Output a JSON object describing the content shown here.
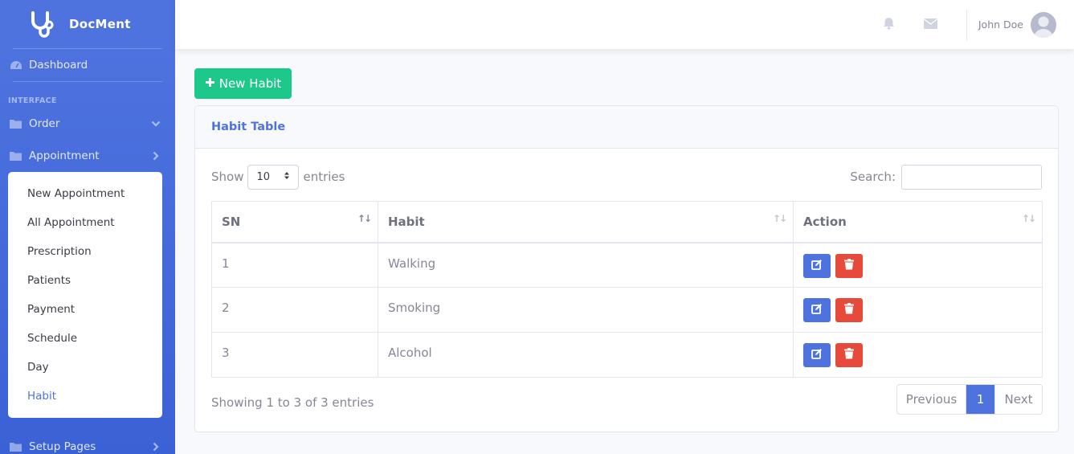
{
  "brand": {
    "name": "DocMent"
  },
  "sidebar": {
    "dashboard": "Dashboard",
    "heading": "INTERFACE",
    "order": "Order",
    "appointment": "Appointment",
    "submenu": [
      "New Appointment",
      "All Appointment",
      "Prescription",
      "Patients",
      "Payment",
      "Schedule",
      "Day",
      "Habit"
    ],
    "active_sub": "Habit",
    "setup": "Setup Pages"
  },
  "topbar": {
    "user_name": "John Doe"
  },
  "page": {
    "new_button": "New Habit",
    "card_title": "Habit Table",
    "show_label": "Show",
    "entries_value": "10",
    "entries_label": "entries",
    "search_label": "Search:",
    "search_value": "",
    "columns": [
      "SN",
      "Habit",
      "Action"
    ],
    "rows": [
      {
        "sn": "1",
        "habit": "Walking"
      },
      {
        "sn": "2",
        "habit": "Smoking"
      },
      {
        "sn": "3",
        "habit": "Alcohol"
      }
    ],
    "info": "Showing 1 to 3 of 3 entries",
    "pagination": {
      "previous": "Previous",
      "current": "1",
      "next": "Next"
    }
  },
  "colors": {
    "primary": "#4e73df",
    "success": "#1cc88a",
    "danger": "#e74a3b"
  },
  "icons": [
    "stethoscope-icon",
    "tachometer-icon",
    "folder-icon",
    "chevron-down-icon",
    "chevron-right-icon",
    "bell-icon",
    "envelope-icon",
    "plus-icon",
    "edit-icon",
    "trash-icon",
    "sort-icon"
  ]
}
